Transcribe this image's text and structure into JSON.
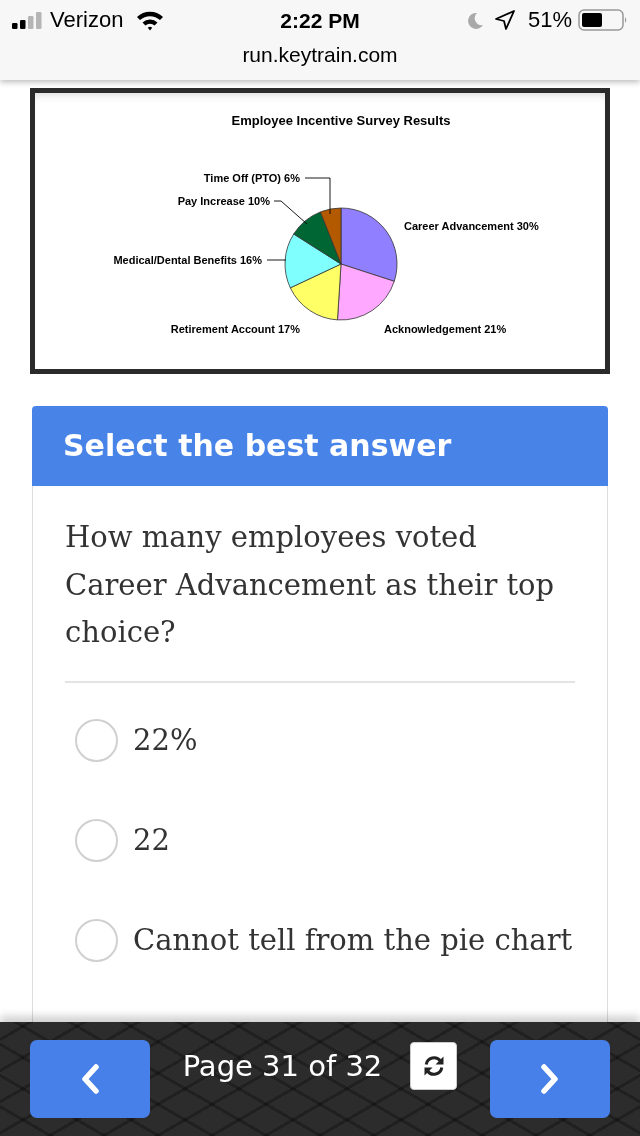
{
  "status_bar": {
    "carrier": "Verizon",
    "time": "2:22 PM",
    "battery": "51%"
  },
  "address_bar": {
    "url": "run.keytrain.com"
  },
  "figure": {
    "chart_data": {
      "type": "pie",
      "title": "Employee Incentive Survey Results",
      "categories": [
        "Career Advancement",
        "Acknowledgement",
        "Retirement Account",
        "Medical/Dental Benefits",
        "Pay Increase",
        "Time Off (PTO)"
      ],
      "values": [
        30,
        21,
        17,
        16,
        10,
        6
      ],
      "value_labels": [
        "30%",
        "21%",
        "17%",
        "16%",
        "10%",
        "6%"
      ],
      "colors": [
        "#9080ff",
        "#ffa8ff",
        "#ffff66",
        "#80ffff",
        "#006633",
        "#b35a00"
      ]
    }
  },
  "question": {
    "header": "Select the best answer",
    "text": "How many employees voted Career Advancement as their top choice?",
    "options": [
      {
        "label": "22%",
        "selected": false
      },
      {
        "label": "22",
        "selected": false
      },
      {
        "label": "Cannot tell from the pie chart",
        "selected": false
      }
    ]
  },
  "pager": {
    "text": "Page 31 of 32"
  }
}
